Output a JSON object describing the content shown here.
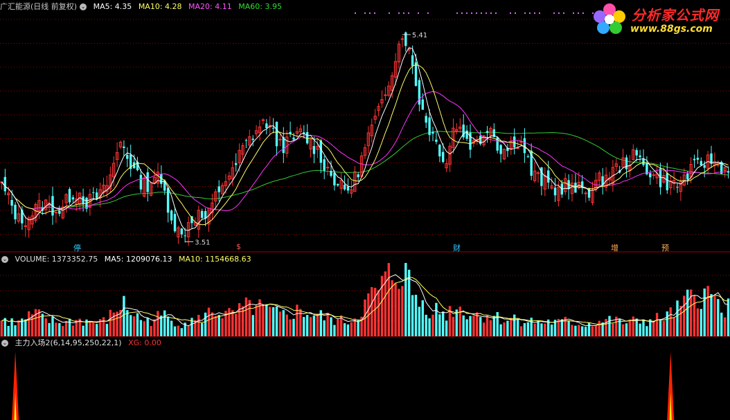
{
  "main_header": {
    "title": "广汇能源(日线 前复权)",
    "ma5": "MA5: 4.35",
    "ma10": "MA10: 4.28",
    "ma20": "MA20: 4.11",
    "ma60": "MA60: 3.95"
  },
  "volume_header": {
    "volume": "VOLUME: 1373352.75",
    "ma5": "MA5: 1209076.13",
    "ma10": "MA10: 1154668.63"
  },
  "indicator_header": {
    "name": "主力入场2(6,14,95,250,22,1)",
    "xg": "XG: 0.00"
  },
  "logo": {
    "title": "分析家公式网",
    "url": "www.88gs.com"
  },
  "annotations": {
    "high_label": "5.41",
    "low_label": "3.51",
    "markers": [
      "停",
      "$",
      "财",
      "增",
      "预"
    ]
  },
  "colors": {
    "up": "#ff3333",
    "down": "#54ffff",
    "ma5": "#ffffff",
    "ma10": "#ffff66",
    "ma20": "#ff33ff",
    "ma60": "#33cc33",
    "grid": "#a00000",
    "signal": "#ff2200",
    "signal_core": "#ffff00"
  },
  "chart_data": {
    "type": "candlestick",
    "y_range": [
      3.45,
      5.5
    ],
    "n_bars": 215,
    "price_path": [
      4.0,
      3.85,
      3.7,
      3.72,
      3.8,
      3.85,
      3.8,
      3.78,
      3.92,
      3.95,
      3.85,
      3.9,
      3.95,
      4.15,
      4.4,
      4.2,
      4.05,
      4.0,
      4.1,
      3.95,
      3.7,
      3.55,
      3.7,
      3.75,
      3.7,
      3.9,
      4.05,
      4.1,
      4.3,
      4.4,
      4.5,
      4.55,
      4.4,
      4.35,
      4.4,
      4.45,
      4.38,
      4.3,
      4.15,
      4.05,
      3.95,
      4.0,
      4.2,
      4.45,
      4.6,
      4.85,
      5.1,
      5.35,
      5.05,
      4.7,
      4.5,
      4.35,
      4.2,
      4.55,
      4.45,
      4.35,
      4.4,
      4.55,
      4.35,
      4.3,
      4.4,
      4.35,
      4.1,
      4.05,
      4.0,
      3.95,
      4.02,
      3.95,
      3.98,
      3.95,
      4.05,
      4.1,
      4.15,
      4.2,
      4.25,
      4.2,
      4.1,
      4.05,
      4.02,
      4.0,
      4.08,
      4.15,
      4.2,
      4.22,
      4.18,
      4.12
    ],
    "volume_path": [
      0.22,
      0.2,
      0.18,
      0.25,
      0.3,
      0.22,
      0.2,
      0.18,
      0.2,
      0.22,
      0.2,
      0.18,
      0.2,
      0.3,
      0.45,
      0.35,
      0.25,
      0.2,
      0.25,
      0.28,
      0.22,
      0.18,
      0.2,
      0.22,
      0.3,
      0.35,
      0.3,
      0.28,
      0.35,
      0.4,
      0.38,
      0.35,
      0.3,
      0.28,
      0.32,
      0.35,
      0.3,
      0.28,
      0.25,
      0.22,
      0.2,
      0.22,
      0.35,
      0.5,
      0.6,
      0.75,
      0.85,
      0.95,
      0.6,
      0.45,
      0.4,
      0.35,
      0.3,
      0.4,
      0.35,
      0.3,
      0.28,
      0.3,
      0.25,
      0.22,
      0.25,
      0.22,
      0.2,
      0.18,
      0.2,
      0.18,
      0.2,
      0.18,
      0.16,
      0.18,
      0.2,
      0.22,
      0.2,
      0.18,
      0.2,
      0.22,
      0.2,
      0.25,
      0.28,
      0.35,
      0.45,
      0.55,
      0.6,
      0.5,
      0.45,
      0.4
    ],
    "signals": [
      0.0,
      0.0
    ],
    "overlays": [
      "MA5",
      "MA10",
      "MA20",
      "MA60"
    ]
  }
}
